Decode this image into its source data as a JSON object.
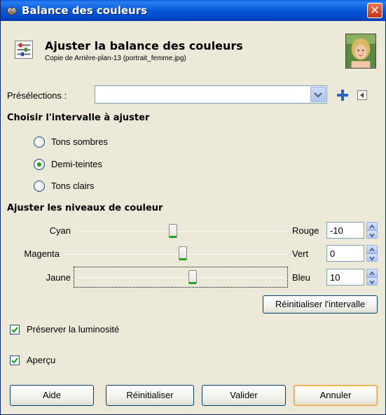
{
  "window": {
    "title": "Balance des couleurs",
    "close_label": "✕"
  },
  "header": {
    "title": "Ajuster la balance des couleurs",
    "subtitle": "Copie de Arrière-plan-13 (portrait_femme.jpg)"
  },
  "presets": {
    "label": "Présélections :",
    "value": ""
  },
  "range_section": {
    "title": "Choisir l'intervalle à ajuster",
    "options": [
      {
        "label": "Tons sombres",
        "selected": false
      },
      {
        "label": "Demi-teintes",
        "selected": true
      },
      {
        "label": "Tons clairs",
        "selected": false
      }
    ]
  },
  "levels_section": {
    "title": "Ajuster les niveaux de couleur",
    "sliders": [
      {
        "left": "Cyan",
        "right": "Rouge",
        "value": "-10",
        "level": -10
      },
      {
        "left": "Magenta",
        "right": "Vert",
        "value": "0",
        "level": 0
      },
      {
        "left": "Jaune",
        "right": "Bleu",
        "value": "10",
        "level": 10
      }
    ],
    "reset_range_label": "Réinitialiser l'intervalle"
  },
  "options": {
    "preserve_luminosity": {
      "label": "Préserver la luminosité",
      "checked": true
    },
    "preview": {
      "label": "Aperçu",
      "checked": true
    }
  },
  "buttons": {
    "help": "Aide",
    "reset": "Réinitialiser",
    "ok": "Valider",
    "cancel": "Annuler"
  },
  "colors": {
    "titlebar": "#0858d8",
    "accent_green": "#21a121",
    "close_red": "#d24a24"
  }
}
